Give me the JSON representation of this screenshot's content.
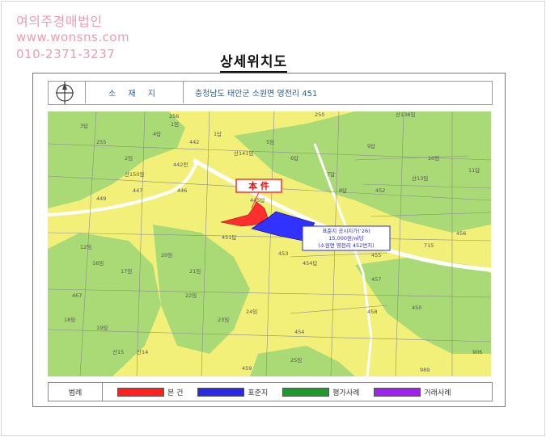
{
  "watermark": {
    "company": "여의주경매법인",
    "website": "www.wonsns.com",
    "phone": "010-2371-3237"
  },
  "page": {
    "title": "상세위치도"
  },
  "header": {
    "location_label": "소 재 지",
    "location_value": "충청남도 태안군 소원면 영전리 451"
  },
  "map": {
    "subject_label": "本 件",
    "standard_land_note": [
      "표준지 공시지가(‘26)",
      "15,000원/㎡당",
      "(소원면 영전리 452번지)"
    ],
    "parcel_labels": [
      "256",
      "250",
      "산138임",
      "255",
      "산141임",
      "452",
      "442",
      "442전",
      "산150임",
      "449",
      "445답",
      "451답",
      "453",
      "454답",
      "457",
      "458",
      "450",
      "456",
      "715",
      "467",
      "459",
      "989",
      "906",
      "산15",
      "산14",
      "산13임",
      "447",
      "446",
      "454",
      "455",
      "1임",
      "1답",
      "2임",
      "3답",
      "4답",
      "5임",
      "6답",
      "7답",
      "8답",
      "9답",
      "10임",
      "11답",
      "12임",
      "16임",
      "17임",
      "18임",
      "19임",
      "20임",
      "21임",
      "22임",
      "23임",
      "24임",
      "25임"
    ],
    "colors": {
      "forest": "#a9da76",
      "farmland": "#f3f07a",
      "road": "#ffffff",
      "subject": "#ff2f2f",
      "standard": "#3232ff"
    }
  },
  "legend": {
    "title": "범례",
    "items": [
      {
        "label": "본 건",
        "color": "#ff2020"
      },
      {
        "label": "표준지",
        "color": "#2a2ae6"
      },
      {
        "label": "평가사례",
        "color": "#1f9a2a"
      },
      {
        "label": "거래사례",
        "color": "#a020f0"
      }
    ]
  }
}
